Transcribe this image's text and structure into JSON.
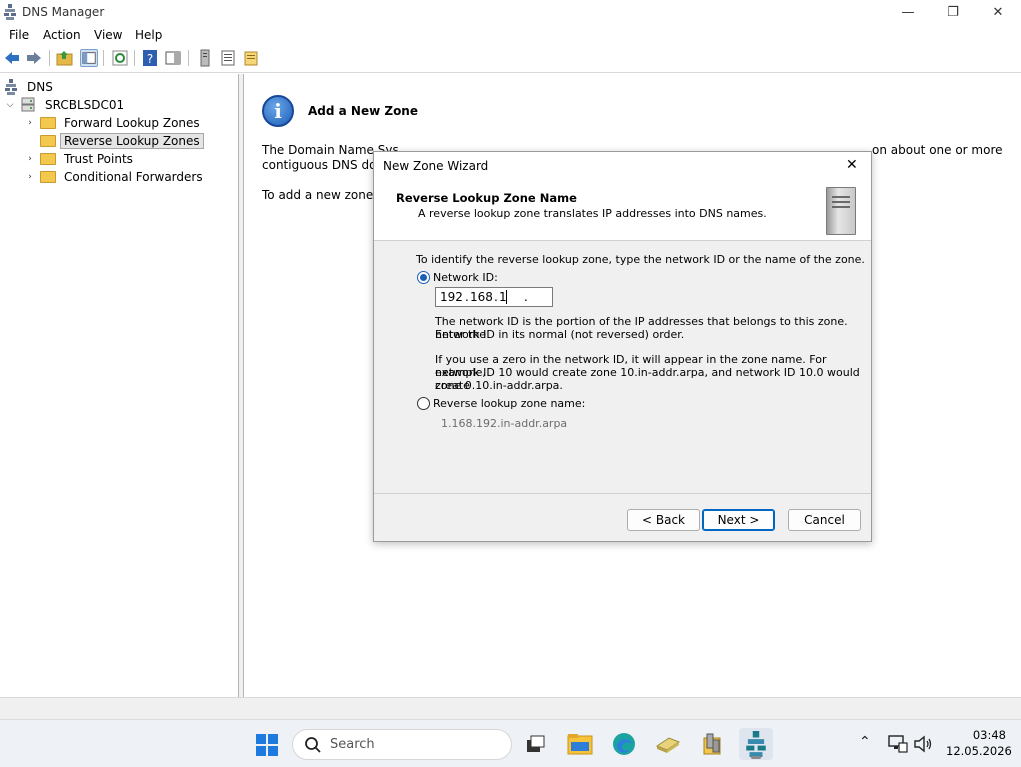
{
  "window": {
    "title": "DNS Manager",
    "controls": {
      "minimize": "—",
      "restore": "❐",
      "close": "✕"
    }
  },
  "menu": [
    "File",
    "Action",
    "View",
    "Help"
  ],
  "tree": {
    "root": "DNS",
    "server": "SRCBLSDC01",
    "items": [
      "Forward Lookup Zones",
      "Reverse Lookup Zones",
      "Trust Points",
      "Conditional Forwarders"
    ],
    "selected": "Reverse Lookup Zones"
  },
  "right_pane": {
    "title": "Add a New Zone",
    "para1_line1_a": "The Domain Name Sys",
    "para1_line1_b": "on about one or more",
    "para1_line2": "contiguous DNS dom",
    "para2": "To add a new zone, o"
  },
  "dialog": {
    "title": "New Zone Wizard",
    "close": "✕",
    "header_title": "Reverse Lookup Zone Name",
    "header_sub": "A reverse lookup zone translates IP addresses into DNS names.",
    "intro": "To identify the reverse lookup zone, type the network ID or the name of the zone.",
    "radio_network_id": "Network ID:",
    "ip": {
      "o1": "192",
      "o2": "168",
      "o3": "1",
      "o4": "",
      "sep": "."
    },
    "help1_l1": "The network ID is the portion of the IP addresses that belongs to this zone. Enter the",
    "help1_l2": "network ID in its normal (not reversed) order.",
    "help2_l1": "If you use a zero in the network ID, it will appear in the zone name. For example,",
    "help2_l2": "network ID 10 would create zone 10.in-addr.arpa, and network ID 10.0 would create",
    "help2_l3": "zone 0.10.in-addr.arpa.",
    "radio_zone_name": "Reverse lookup zone name:",
    "zone_name_value": "1.168.192.in-addr.arpa",
    "buttons": {
      "back": "< Back",
      "next": "Next >",
      "cancel": "Cancel"
    }
  },
  "taskbar": {
    "search_placeholder": "Search",
    "time": "03:48",
    "date": "12.05.2026",
    "chevron": "⌃"
  },
  "colors": {
    "accent": "#1a5fb4",
    "folder": "#f2c94c",
    "taskbar": "#eef1f5"
  }
}
